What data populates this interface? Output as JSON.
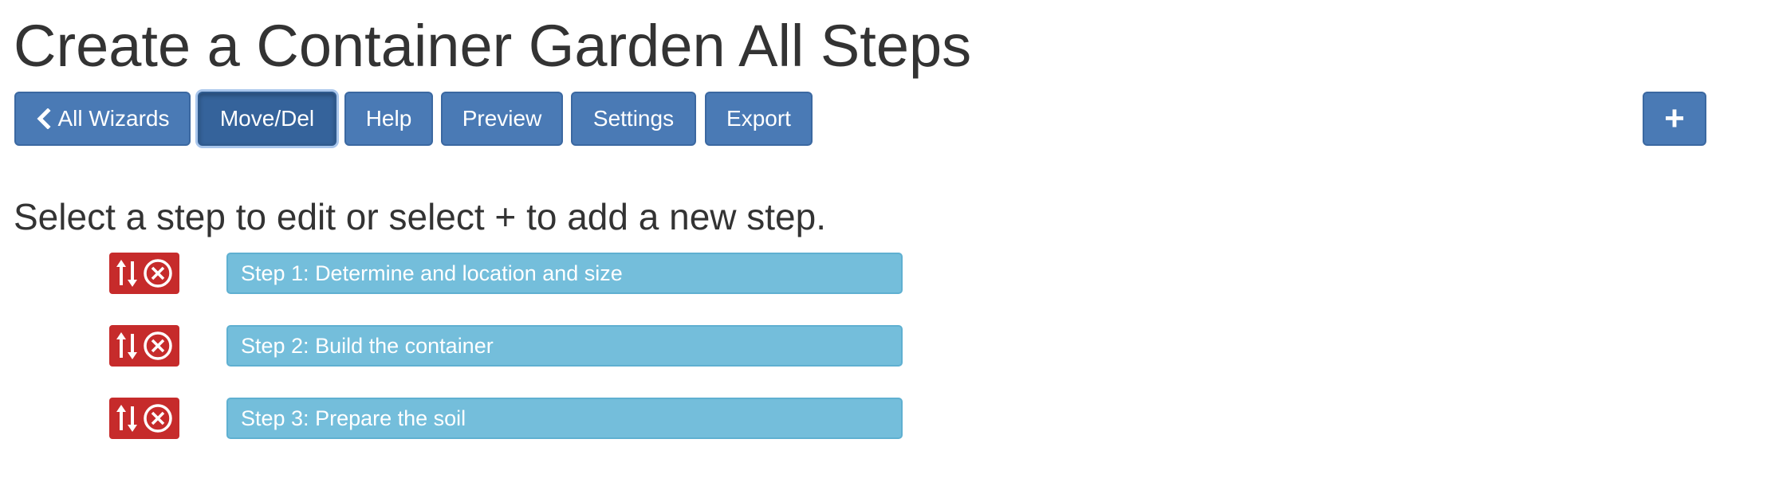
{
  "page": {
    "title": "Create a Container Garden All Steps"
  },
  "toolbar": {
    "all_wizards_label": "All Wizards",
    "move_del_label": "Move/Del",
    "help_label": "Help",
    "preview_label": "Preview",
    "settings_label": "Settings",
    "export_label": "Export",
    "add_label": "+",
    "active_button": "Move/Del"
  },
  "instruction": "Select a step to edit or select + to add a new step.",
  "steps": [
    {
      "label": "Step 1: Determine and location and size"
    },
    {
      "label": "Step 2: Build the container"
    },
    {
      "label": "Step 3: Prepare the soil"
    }
  ],
  "colors": {
    "primary_button": "#4a7ab5",
    "active_button": "#35639b",
    "step_button": "#74bedb",
    "move_delete": "#c62b2b",
    "text": "#333333"
  },
  "icons": {
    "back": "chevron-left-icon",
    "move": "sort-arrows-icon",
    "delete": "circle-x-icon"
  }
}
